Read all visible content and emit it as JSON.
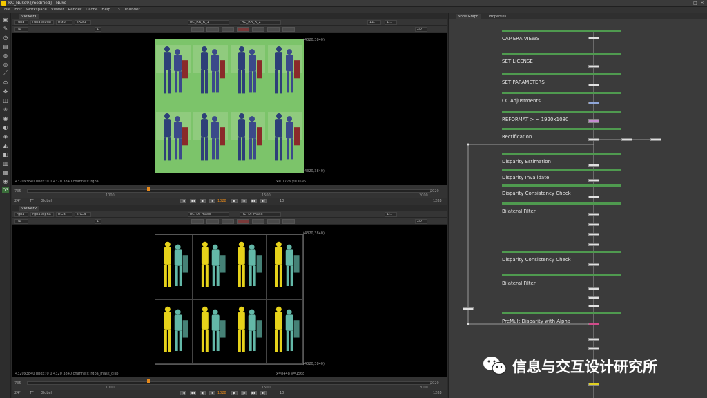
{
  "window": {
    "title": "RC_Nuke9.[modified] - Nuke"
  },
  "menu": [
    "File",
    "Edit",
    "Workspace",
    "Viewer",
    "Render",
    "Cache",
    "Help",
    "O3",
    "Thunder"
  ],
  "viewer1": {
    "tab": "Viewer1",
    "channels": "rgba",
    "layer": "rgba.alpha",
    "colorspace": "RGB",
    "lut": "sRGB",
    "input_a": "RC_RR_R_1",
    "input_b": "RC_RR_R_2",
    "gain": "f/8",
    "gamma": "1",
    "zoom": "2D",
    "fit": "1:1",
    "frame_count": "12.7",
    "format_label": "4320x3840",
    "status": "4320x3840  bbox: 0 0 4320 3840 channels: rgba",
    "coords": "x= 1776 y=3696",
    "corner_tr": "(4320,3840)",
    "corner_br": "(4320,3840)",
    "timeline": {
      "start": "735",
      "end": "2020",
      "t1": "1000",
      "t2": "1500",
      "t3": "2000",
      "in": "738",
      "out": "2020"
    },
    "playback": {
      "fps": "24*",
      "tf": "TF",
      "mode": "Global",
      "frame": "1028",
      "step": "10",
      "end": "1283"
    }
  },
  "viewer2": {
    "tab": "Viewer2",
    "channels": "rgba",
    "layer": "rgba.alpha",
    "colorspace": "RGB",
    "lut": "sRGB",
    "input_a": "RC_DI_mask",
    "input_b": "RC_DI_mask",
    "gain": "f/8",
    "gamma": "1",
    "zoom": "2D",
    "fit": "1:1",
    "format_label": "4320x3840",
    "status": "4320x3840  bbox: 0 0 4320 3840 channels: rgba_mask_disp",
    "coords": "x=8448 y=1568",
    "corner_tr": "(4320,3840)",
    "corner_br": "(4320,3840)",
    "timeline": {
      "start": "735",
      "end": "2020",
      "t1": "1000",
      "t2": "1500",
      "t3": "2000",
      "in": "738",
      "out": "2020"
    },
    "playback": {
      "fps": "24*",
      "tf": "TF",
      "mode": "Global",
      "frame": "1028",
      "step": "10",
      "end": "1283"
    }
  },
  "node_panel": {
    "tabs": [
      "Node Graph",
      "Properties"
    ],
    "backdrops": [
      "CAMERA VIEWS",
      "SET LICENSE",
      "SET PARAMETERS",
      "CC Adjustments",
      "REFORMAT > ~ 1920x1080",
      "Rectification",
      "Disparity Estimation",
      "Disparity Invalidate",
      "Disparity Consistency Check",
      "Bilateral Filter",
      "Disparity Consistency Check",
      "Bilateral Filter",
      "PreMult Disparity with Alpha"
    ]
  },
  "colors": {
    "backdrop_green": "#4f9a4f",
    "accent_orange": "#e88a1a",
    "node_cc": "#8fa6d8",
    "node_reformat": "#c58ad0",
    "node_premult": "#d14b8a",
    "node_write": "#e0d020",
    "green_screen": "#7cc46a",
    "disparity_yellow": "#e6d21a",
    "disparity_teal": "#63b8a8"
  },
  "watermark": {
    "text": "信息与交互设计研究所",
    "icon": "wechat-icon"
  }
}
